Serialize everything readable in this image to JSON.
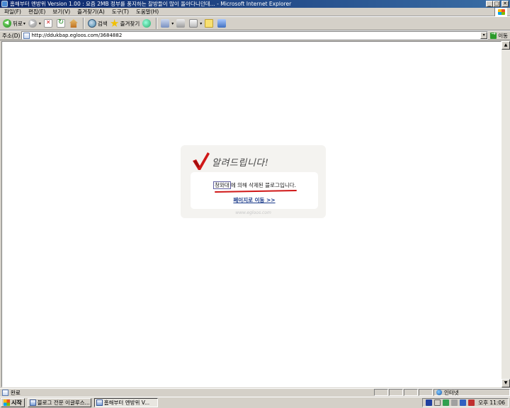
{
  "window": {
    "title": "홈해부터 멘방위 Version 1.00 : 요즘 2MB 정부를 풍지하는 찰방들이 많이 돌아다니던데... - Microsoft Internet Explorer",
    "controls": {
      "minimize": "_",
      "maximize": "□",
      "close": "✕"
    }
  },
  "menu": {
    "items": [
      "파일(F)",
      "편집(E)",
      "보기(V)",
      "즐겨찾기(A)",
      "도구(T)",
      "도움말(H)"
    ]
  },
  "toolbar": {
    "back_label": "뒤로",
    "search_label": "검색",
    "favorites_label": "즐겨찾기",
    "dropdown_glyph": "▾"
  },
  "address": {
    "label": "주소(D)",
    "url": "http://ddukbap.egloos.com/3684882",
    "dropdown_glyph": "▾",
    "go_label": "이동"
  },
  "page": {
    "heading": "알려드립니다!",
    "message_highlight": "청와대",
    "message_rest": "에 의해 삭제된 블로그입니다.",
    "link_label": "페이지로 이동 >>",
    "footer": "www.egloos.com",
    "colors": {
      "check": "#d01818",
      "underline": "#d01818",
      "link": "#1a3a8a"
    }
  },
  "statusbar": {
    "text": "완료",
    "zone": "인터넷"
  },
  "taskbar": {
    "start_label": "시작",
    "tasks": [
      {
        "label": "블로그 전문 이글루스...",
        "active": false
      },
      {
        "label": "홈해부터 멘방위 V...",
        "active": true
      }
    ],
    "clock": "오후 11:06"
  },
  "scrollbar": {
    "up_glyph": "▲",
    "down_glyph": "▼"
  }
}
